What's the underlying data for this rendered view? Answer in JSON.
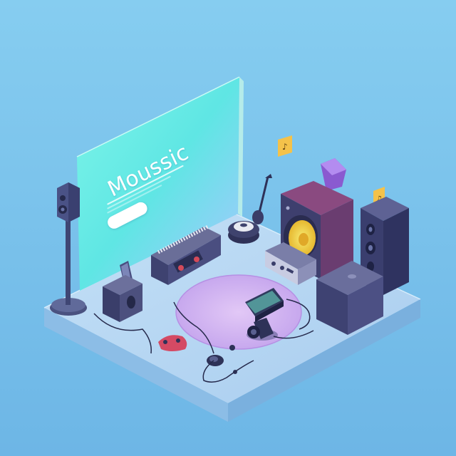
{
  "screen": {
    "title": "Moussic",
    "button_label": "",
    "tiny_label": ""
  },
  "colors": {
    "background": "#7dc4ea",
    "platform_top": "#b8d8f2",
    "screen_gradient_start": "#5ff0e0",
    "screen_gradient_end": "#a6c8ff",
    "speaker_body": "#4a4f7a",
    "speaker_accent": "#7a3d70",
    "woofer_cone": "#f2dc4a",
    "rug": "#d4b8f2"
  },
  "icons": [
    "speaker-stand-icon",
    "guitar-icon",
    "amplifier-icon",
    "cassette-player-icon",
    "camera-icon",
    "game-controller-icon",
    "earbuds-icon",
    "music-note-icon"
  ]
}
